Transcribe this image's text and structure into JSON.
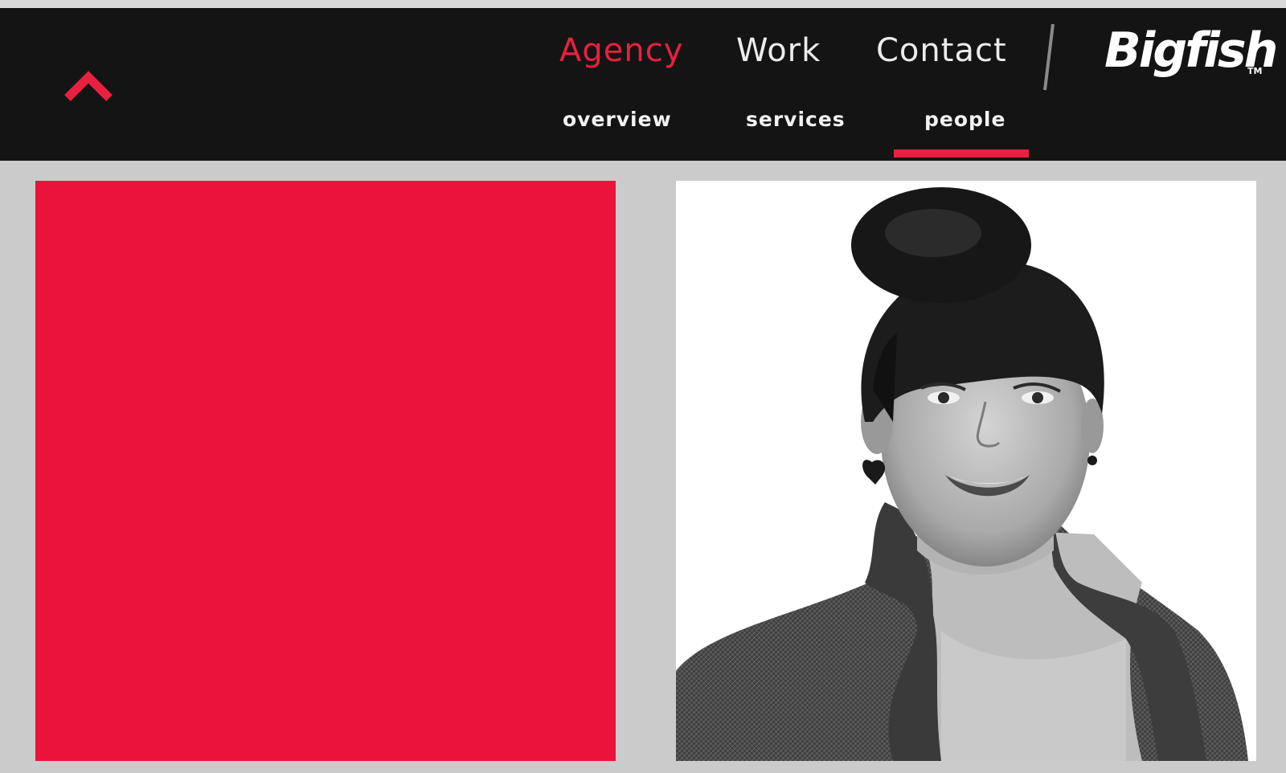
{
  "header": {
    "logo_text": "Bigfish",
    "logo_tm": "TM",
    "main_nav": [
      {
        "label": "Agency",
        "active": true
      },
      {
        "label": "Work",
        "active": false
      },
      {
        "label": "Contact",
        "active": false
      }
    ],
    "sub_nav": [
      {
        "label": "overview",
        "active": false
      },
      {
        "label": "services",
        "active": false
      },
      {
        "label": "people",
        "active": true
      }
    ],
    "back_to_top_icon": "chevron-up-icon"
  },
  "main": {
    "tiles": [
      {
        "type": "color-block",
        "color": "#eb133b"
      },
      {
        "type": "portrait",
        "style": "black-and-white"
      }
    ]
  },
  "colors": {
    "accent": "#e9203f",
    "nav_background": "#141414",
    "page_background": "#cbcbcb"
  }
}
